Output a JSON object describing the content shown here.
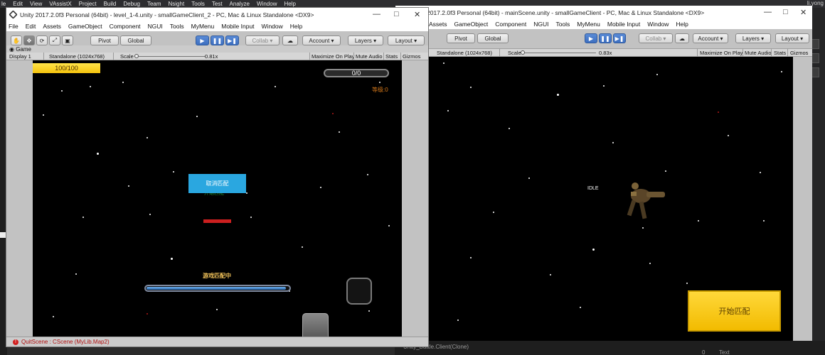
{
  "vs": {
    "menu": [
      "le",
      "Edit",
      "View",
      "VAssistX",
      "Project",
      "Build",
      "Debug",
      "Team",
      "Nsight",
      "Tools",
      "Test",
      "Analyze",
      "Window",
      "Help"
    ],
    "user": "li.yong",
    "bottom_clone": "Unity_Battle.Client(Clone)",
    "bottom_num": "0",
    "bottom_text": "Text"
  },
  "unity_left": {
    "title": "Unity 2017.2.0f3 Personal (64bit) - level_1-4.unity - smallGameClient_2 - PC, Mac & Linux Standalone <DX9>",
    "menu": [
      "File",
      "Edit",
      "Assets",
      "GameObject",
      "Component",
      "NGUI",
      "Tools",
      "MyMenu",
      "Mobile Input",
      "Window",
      "Help"
    ],
    "toolbar": {
      "pivot": "Pivot",
      "global": "Global",
      "collab": "Collab ▾",
      "account": "Account",
      "layers": "Layers",
      "layout": "Layout"
    },
    "game_tab": "Game",
    "display": "Display 1",
    "resolution": "Standalone (1024x768)",
    "scale_label": "Scale",
    "scale_value": "0.81x",
    "maximize": "Maximize On Play",
    "mute": "Mute Audio",
    "stats": "Stats",
    "gizmos": "Gizmos",
    "hp_text": "100/100",
    "score_text": "0/0",
    "level_text": "等级:0",
    "cancel_match": "取消匹配",
    "ghost_text": "开始匹配",
    "matching_text": "游戏匹配中",
    "match_progress": 0.98,
    "status_text": "QuitScene : CScene (MyLib.Map2)"
  },
  "unity_right": {
    "title": "2017.2.0f3 Personal (64bit) - mainScene.unity - smallGameClient - PC, Mac & Linux Standalone <DX9>",
    "menu": [
      "Assets",
      "GameObject",
      "Component",
      "NGUI",
      "Tools",
      "MyMenu",
      "Mobile Input",
      "Window",
      "Help"
    ],
    "toolbar": {
      "pivot": "Pivot",
      "global": "Global",
      "collab": "Collab ▾",
      "account": "Account",
      "layers": "Layers",
      "layout": "Layout"
    },
    "resolution": "Standalone (1024x768)",
    "scale_label": "Scale",
    "scale_value": "0.83x",
    "maximize": "Maximize On Play",
    "mute": "Mute Audio",
    "stats": "Stats",
    "gizmos": "Gizmos",
    "idle_text": "IDLE",
    "start_match": "开始匹配"
  },
  "colors": {
    "start_button": "#f5c400",
    "cancel_button": "#2aa7e0",
    "hp_bar": "#f8d21c",
    "level_text": "#d7791a"
  },
  "icons": [
    "unity-logo-icon",
    "hand-tool-icon",
    "move-tool-icon",
    "rotate-tool-icon",
    "scale-tool-icon",
    "rect-tool-icon",
    "play-icon",
    "pause-icon",
    "step-icon",
    "cloud-icon",
    "error-icon",
    "minimize-icon",
    "maximize-icon",
    "close-icon"
  ]
}
